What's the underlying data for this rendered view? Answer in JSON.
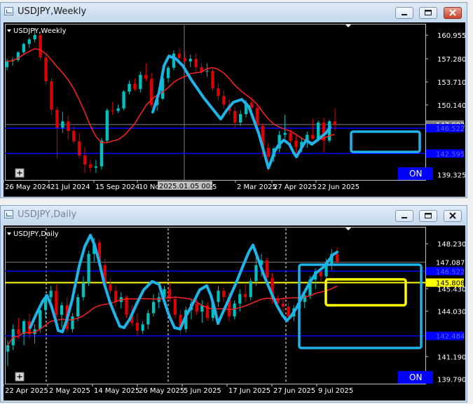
{
  "windows": [
    {
      "id": "weekly",
      "title": "USDJPY,Weekly",
      "chart_label": "USDJPY,Weekly",
      "on_label": "ON",
      "price_labels": [
        "160.955",
        "157.280",
        "153.710",
        "150.140",
        "147.093",
        "146.522",
        "142.595",
        "139.325"
      ],
      "date_labels": [
        "26 May 2024",
        "21 Jul 2024",
        "15 Sep 2024",
        "10 No",
        "2025.01.05 00:00",
        "5",
        "2 Mar 2025",
        "27 Apr 2025",
        "22 Jun 2025"
      ]
    },
    {
      "id": "daily",
      "title": "USDJPY,Daily",
      "chart_label": "USDJPY,Daily",
      "on_label": "ON",
      "price_labels": [
        "148.230",
        "147.087",
        "146.522",
        "145.808",
        "145.430",
        "144.030",
        "142.484",
        "141.190",
        "139.790"
      ],
      "date_labels": [
        "22 Apr 2025",
        "2 May 2025",
        "14 May 2025",
        "26 May 2025",
        "5 Jun 2025",
        "17 Jun 2025",
        "27 Jun 2025",
        "9 Jul 2025"
      ]
    }
  ],
  "colors": {
    "background": "#000000",
    "bull_candle": "#00c0c0",
    "bear_candle": "#e00000",
    "moving_average": "#ff2020",
    "support_line": "#0000ff",
    "yellow_line": "#ffff00",
    "drawing": "#1eb4ea",
    "on_button": "#0000ff"
  },
  "chart_data": [
    {
      "type": "candlestick",
      "symbol": "USDJPY",
      "timeframe": "Weekly",
      "ylim": [
        138.5,
        162.5
      ],
      "horizontal_lines": [
        146.522,
        142.595
      ],
      "current_price": 147.093,
      "candles": [
        [
          156.0,
          157.3,
          155.5,
          156.9
        ],
        [
          156.9,
          157.5,
          156.2,
          157.1
        ],
        [
          157.1,
          158.5,
          156.8,
          158.3
        ],
        [
          158.3,
          159.8,
          157.9,
          159.6
        ],
        [
          159.6,
          160.6,
          159.0,
          160.3
        ],
        [
          160.3,
          161.9,
          159.8,
          161.0
        ],
        [
          161.0,
          161.5,
          157.0,
          157.5
        ],
        [
          157.5,
          158.0,
          153.2,
          153.8
        ],
        [
          153.8,
          154.3,
          148.6,
          149.4
        ],
        [
          149.4,
          149.8,
          141.8,
          146.6
        ],
        [
          146.6,
          149.1,
          145.8,
          147.6
        ],
        [
          147.6,
          148.5,
          144.8,
          146.1
        ],
        [
          146.1,
          146.8,
          144.1,
          144.5
        ],
        [
          144.5,
          145.8,
          141.8,
          142.3
        ],
        [
          142.3,
          143.6,
          139.6,
          140.9
        ],
        [
          140.9,
          141.7,
          139.7,
          140.4
        ],
        [
          140.4,
          141.6,
          139.6,
          140.6
        ],
        [
          140.6,
          145.0,
          140.1,
          144.6
        ],
        [
          144.6,
          149.6,
          144.2,
          149.3
        ],
        [
          149.3,
          150.6,
          148.6,
          149.2
        ],
        [
          149.2,
          150.2,
          148.9,
          149.6
        ],
        [
          149.6,
          152.4,
          149.3,
          152.2
        ],
        [
          152.2,
          153.9,
          151.8,
          153.4
        ],
        [
          153.4,
          154.2,
          152.3,
          152.6
        ],
        [
          152.6,
          155.3,
          152.1,
          154.8
        ],
        [
          154.8,
          156.6,
          153.8,
          154.2
        ],
        [
          154.2,
          155.1,
          149.6,
          150.1
        ],
        [
          150.1,
          151.3,
          149.2,
          151.1
        ],
        [
          151.1,
          154.6,
          150.9,
          154.3
        ],
        [
          154.3,
          156.2,
          153.6,
          155.9
        ],
        [
          155.9,
          158.6,
          155.5,
          158.1
        ],
        [
          158.1,
          158.9,
          156.7,
          157.4
        ],
        [
          157.4,
          158.3,
          155.1,
          156.9
        ],
        [
          156.9,
          157.9,
          156.0,
          157.3
        ],
        [
          157.3,
          158.2,
          155.4,
          156.0
        ],
        [
          156.0,
          156.7,
          154.8,
          155.3
        ],
        [
          155.3,
          156.6,
          154.5,
          155.4
        ],
        [
          155.4,
          155.8,
          152.3,
          152.7
        ],
        [
          152.7,
          153.5,
          150.8,
          151.5
        ],
        [
          151.5,
          152.4,
          149.6,
          150.2
        ],
        [
          150.2,
          151.0,
          148.6,
          149.2
        ],
        [
          149.2,
          149.8,
          146.6,
          147.4
        ],
        [
          147.4,
          149.3,
          146.9,
          148.7
        ],
        [
          148.7,
          150.9,
          148.2,
          150.5
        ],
        [
          150.5,
          151.3,
          149.0,
          149.7
        ],
        [
          149.7,
          150.3,
          146.3,
          146.9
        ],
        [
          146.9,
          147.3,
          142.1,
          143.5
        ],
        [
          143.5,
          144.2,
          139.9,
          142.1
        ],
        [
          142.1,
          143.6,
          141.3,
          143.4
        ],
        [
          143.4,
          146.1,
          142.8,
          145.5
        ],
        [
          145.5,
          148.6,
          145.0,
          145.8
        ],
        [
          145.8,
          146.3,
          143.9,
          144.6
        ],
        [
          144.6,
          145.4,
          142.6,
          143.6
        ],
        [
          143.6,
          144.9,
          142.8,
          144.4
        ],
        [
          144.4,
          146.0,
          143.5,
          145.5
        ],
        [
          145.5,
          148.0,
          144.7,
          144.9
        ],
        [
          144.9,
          147.7,
          144.5,
          147.4
        ],
        [
          147.4,
          148.1,
          142.8,
          144.6
        ],
        [
          144.6,
          147.8,
          144.3,
          147.6
        ],
        [
          147.6,
          149.6,
          146.2,
          147.1
        ]
      ]
    },
    {
      "type": "candlestick",
      "symbol": "USDJPY",
      "timeframe": "Daily",
      "ylim": [
        139.5,
        149.2
      ],
      "horizontal_lines": [
        146.522,
        145.808,
        142.484
      ],
      "current_price": 147.087,
      "candles": [
        [
          141.5,
          142.2,
          140.6,
          141.9
        ],
        [
          141.9,
          143.2,
          141.6,
          142.9
        ],
        [
          142.9,
          143.6,
          142.3,
          142.6
        ],
        [
          142.6,
          143.5,
          141.9,
          143.4
        ],
        [
          143.4,
          143.9,
          142.3,
          142.6
        ],
        [
          142.6,
          143.2,
          142.0,
          142.9
        ],
        [
          142.9,
          144.3,
          142.7,
          144.1
        ],
        [
          144.1,
          145.1,
          143.6,
          144.9
        ],
        [
          144.9,
          145.6,
          144.3,
          145.3
        ],
        [
          145.3,
          145.7,
          143.5,
          143.8
        ],
        [
          143.8,
          144.6,
          143.0,
          144.4
        ],
        [
          144.4,
          144.9,
          142.7,
          142.9
        ],
        [
          142.9,
          143.9,
          142.7,
          143.7
        ],
        [
          143.7,
          145.1,
          143.4,
          144.9
        ],
        [
          144.9,
          146.2,
          144.7,
          145.8
        ],
        [
          145.8,
          147.8,
          145.6,
          147.6
        ],
        [
          147.6,
          148.6,
          147.1,
          148.3
        ],
        [
          148.3,
          148.5,
          146.6,
          146.9
        ],
        [
          146.9,
          147.3,
          145.4,
          145.7
        ],
        [
          145.7,
          146.1,
          145.1,
          145.3
        ],
        [
          145.3,
          145.6,
          144.3,
          144.6
        ],
        [
          144.6,
          145.2,
          144.2,
          144.9
        ],
        [
          144.9,
          145.0,
          143.6,
          143.8
        ],
        [
          143.8,
          144.4,
          143.1,
          143.3
        ],
        [
          143.3,
          143.9,
          142.5,
          142.8
        ],
        [
          142.8,
          143.4,
          142.6,
          143.2
        ],
        [
          143.2,
          144.1,
          142.9,
          143.9
        ],
        [
          143.9,
          145.1,
          143.7,
          144.6
        ],
        [
          144.6,
          145.2,
          144.2,
          144.9
        ],
        [
          144.9,
          145.6,
          144.4,
          145.4
        ],
        [
          145.4,
          145.8,
          144.6,
          144.8
        ],
        [
          144.8,
          145.0,
          143.6,
          143.8
        ],
        [
          143.8,
          144.1,
          142.6,
          142.9
        ],
        [
          142.9,
          144.3,
          142.7,
          144.1
        ],
        [
          144.1,
          144.8,
          143.5,
          144.5
        ],
        [
          144.5,
          145.2,
          143.8,
          144.0
        ],
        [
          144.0,
          144.7,
          143.3,
          144.4
        ],
        [
          144.4,
          144.6,
          143.4,
          143.6
        ],
        [
          143.6,
          144.8,
          143.4,
          144.6
        ],
        [
          144.6,
          145.6,
          144.3,
          145.3
        ],
        [
          145.3,
          145.5,
          144.6,
          144.9
        ],
        [
          144.9,
          145.2,
          143.4,
          143.7
        ],
        [
          143.7,
          144.7,
          143.5,
          144.5
        ],
        [
          144.5,
          145.4,
          144.0,
          145.1
        ],
        [
          145.1,
          145.7,
          144.6,
          144.9
        ],
        [
          144.9,
          146.1,
          144.7,
          145.9
        ],
        [
          145.9,
          147.9,
          145.6,
          146.9
        ],
        [
          146.9,
          147.6,
          146.2,
          147.2
        ],
        [
          147.2,
          147.4,
          146.0,
          146.1
        ],
        [
          146.1,
          146.4,
          144.5,
          144.8
        ],
        [
          144.8,
          145.0,
          144.1,
          144.5
        ],
        [
          144.5,
          144.9,
          143.9,
          144.3
        ],
        [
          144.3,
          144.6,
          143.3,
          143.7
        ],
        [
          143.7,
          144.4,
          143.4,
          144.2
        ],
        [
          144.2,
          144.9,
          143.8,
          144.6
        ],
        [
          144.6,
          145.3,
          144.2,
          145.0
        ],
        [
          145.0,
          146.2,
          144.8,
          146.0
        ],
        [
          146.0,
          146.7,
          145.4,
          146.5
        ],
        [
          146.5,
          147.1,
          145.9,
          146.2
        ],
        [
          146.2,
          147.3,
          146.0,
          146.9
        ],
        [
          146.9,
          147.9,
          146.6,
          147.6
        ],
        [
          147.6,
          148.0,
          147.0,
          147.1
        ]
      ]
    }
  ]
}
